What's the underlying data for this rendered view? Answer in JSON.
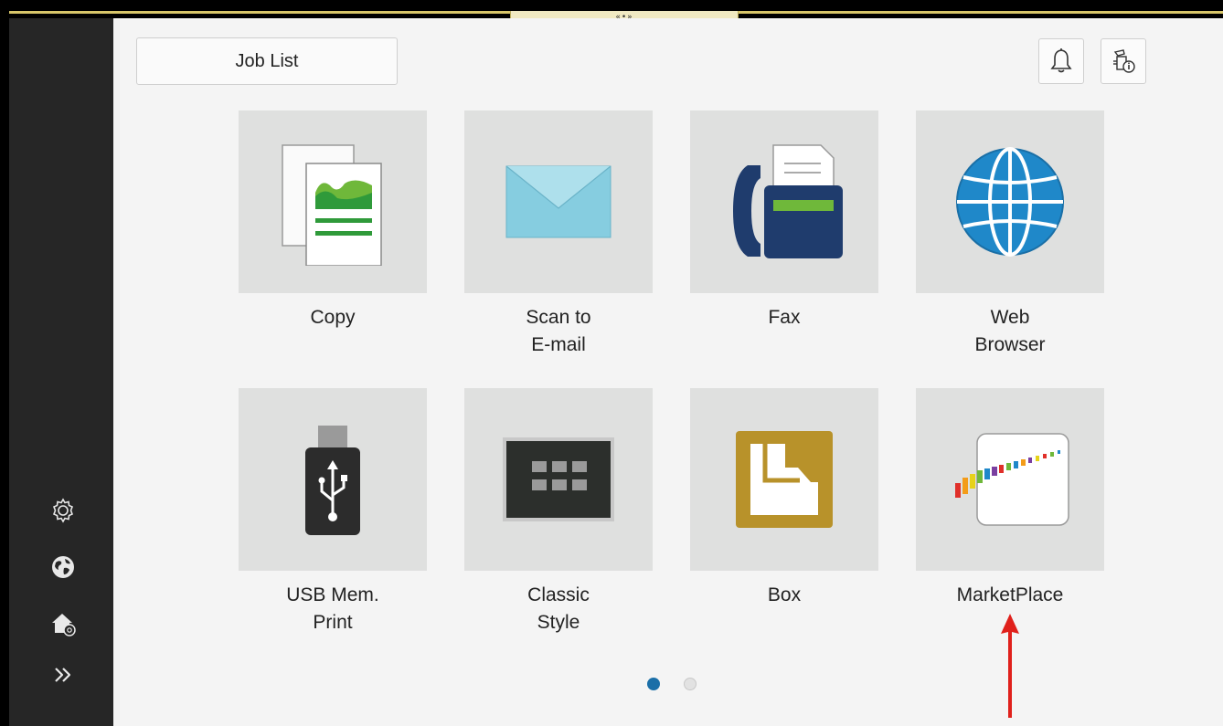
{
  "header": {
    "tab_handle_glyph": "«•»",
    "job_list_label": "Job List",
    "notifications_icon": "bell-icon",
    "device_info_icon": "device-info-icon"
  },
  "sidebar": {
    "items": [
      {
        "icon": "gear-icon"
      },
      {
        "icon": "globe-icon"
      },
      {
        "icon": "home-settings-icon"
      },
      {
        "icon": "double-chevron-right-icon"
      }
    ]
  },
  "apps": [
    {
      "line1": "Copy",
      "line2": "",
      "icon": "copy-icon"
    },
    {
      "line1": "Scan to",
      "line2": "E-mail",
      "icon": "envelope-icon"
    },
    {
      "line1": "Fax",
      "line2": "",
      "icon": "fax-icon"
    },
    {
      "line1": "Web",
      "line2": "Browser",
      "icon": "globe-icon"
    },
    {
      "line1": "USB Mem.",
      "line2": "Print",
      "icon": "usb-icon"
    },
    {
      "line1": "Classic",
      "line2": "Style",
      "icon": "keypad-icon"
    },
    {
      "line1": "Box",
      "line2": "",
      "icon": "box-icon"
    },
    {
      "line1": "MarketPlace",
      "line2": "",
      "icon": "marketplace-icon"
    }
  ],
  "pagination": {
    "current": 1,
    "total": 2
  },
  "colors": {
    "active_dot": "#1b6fa8",
    "inactive_dot": "#d4d4d4",
    "arrow": "#e0201b",
    "sidebar": "#262626",
    "tile": "#dfe0df"
  }
}
